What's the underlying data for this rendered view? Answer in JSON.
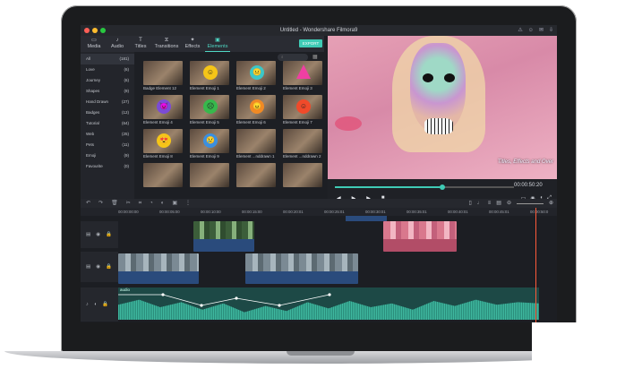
{
  "window": {
    "title": "Untitled - Wondershare Filmora9"
  },
  "tabs": [
    {
      "label": "Media",
      "icon": "folder-icon"
    },
    {
      "label": "Audio",
      "icon": "music-icon"
    },
    {
      "label": "Titles",
      "icon": "text-icon"
    },
    {
      "label": "Transitions",
      "icon": "transition-icon"
    },
    {
      "label": "Effects",
      "icon": "effects-icon"
    },
    {
      "label": "Elements",
      "icon": "elements-icon"
    }
  ],
  "export_label": "EXPORT",
  "categories": [
    {
      "name": "All",
      "count": "(181)"
    },
    {
      "name": "Love",
      "count": "(6)"
    },
    {
      "name": "Journey",
      "count": "(6)"
    },
    {
      "name": "Shapes",
      "count": "(9)"
    },
    {
      "name": "Hand Drawn",
      "count": "(27)"
    },
    {
      "name": "Badges",
      "count": "(12)"
    },
    {
      "name": "Tutorial",
      "count": "(64)"
    },
    {
      "name": "Web",
      "count": "(25)"
    },
    {
      "name": "Pets",
      "count": "(11)"
    },
    {
      "name": "Emoji",
      "count": "(9)"
    },
    {
      "name": "Favourite",
      "count": "(0)"
    }
  ],
  "elements": [
    {
      "label": "Badge Element 12",
      "emoji": ""
    },
    {
      "label": "Element Emoji 1",
      "emoji": "☺"
    },
    {
      "label": "Element Emoji 2",
      "emoji": "😐"
    },
    {
      "label": "Element Emoji 3",
      "emoji": ""
    },
    {
      "label": "Element Emoji 4",
      "emoji": "😈"
    },
    {
      "label": "Element Emoji 5",
      "emoji": "☹"
    },
    {
      "label": "Element Emoji 6",
      "emoji": "😠"
    },
    {
      "label": "Element Emoji 7",
      "emoji": "☺"
    },
    {
      "label": "Element Emoji 8",
      "emoji": "😍"
    },
    {
      "label": "Element Emoji 9",
      "emoji": "😢"
    },
    {
      "label": "Element ...nddrawn 1",
      "emoji": ""
    },
    {
      "label": "Element ...nddrawn 2",
      "emoji": ""
    },
    {
      "label": "",
      "emoji": ""
    },
    {
      "label": "",
      "emoji": ""
    },
    {
      "label": "",
      "emoji": ""
    },
    {
      "label": "",
      "emoji": ""
    }
  ],
  "preview": {
    "caption": "Titles, Effects and Over",
    "timecode": "00:00:50:20"
  },
  "playback_progress": 0.6,
  "ruler": [
    "00:00:00:00",
    "00:00:05:00",
    "00:00:10:00",
    "00:00:15:00",
    "00:00:20:01",
    "00:00:25:01",
    "00:00:30:01",
    "00:00:35:01",
    "00:00:40:01",
    "00:00:45:01",
    "00:00:50:0"
  ],
  "audio_label": "audio",
  "colors": {
    "accent": "#3fcbb5",
    "playhead": "#ff5a3a"
  }
}
